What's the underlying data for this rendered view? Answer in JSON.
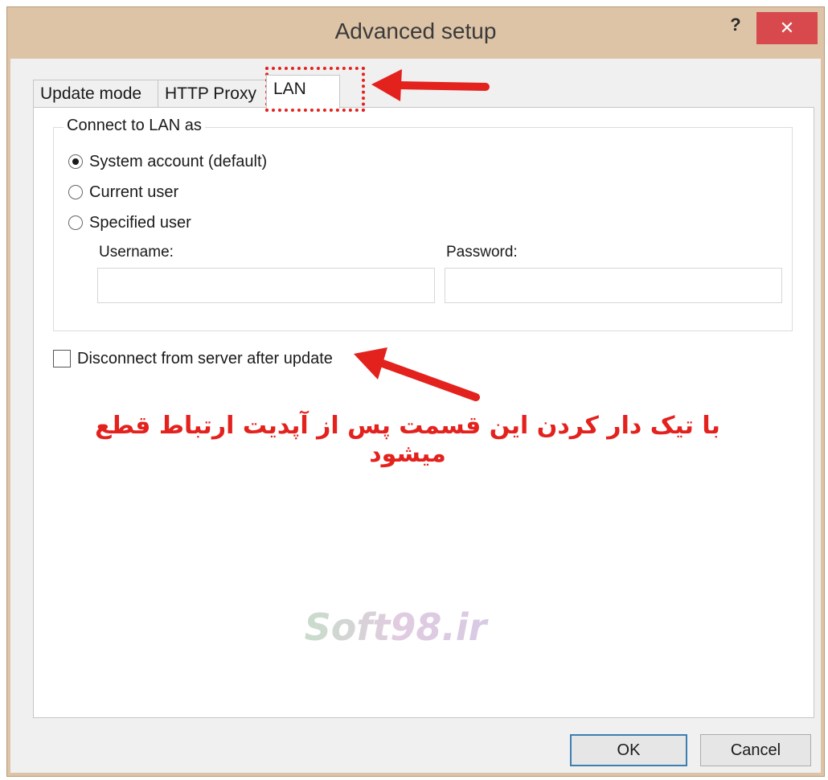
{
  "window": {
    "title": "Advanced setup",
    "help_label": "?",
    "close_label": "✕"
  },
  "tabs": [
    {
      "label": "Update mode",
      "active": false
    },
    {
      "label": "HTTP Proxy",
      "active": false
    },
    {
      "label": "LAN",
      "active": true
    }
  ],
  "connect_group": {
    "title": "Connect to LAN as",
    "options": [
      {
        "label": "System account (default)",
        "selected": true
      },
      {
        "label": "Current user",
        "selected": false
      },
      {
        "label": "Specified user",
        "selected": false
      }
    ],
    "username_label": "Username:",
    "username_value": "",
    "password_label": "Password:",
    "password_value": ""
  },
  "disconnect_checkbox": {
    "label": "Disconnect from server after update",
    "checked": false
  },
  "annotation_text": "با تیک دار کردن این قسمت  پس از آپدیت ارتباط قطع میشود",
  "watermark_text": "Soft98.ir",
  "buttons": {
    "ok": "OK",
    "cancel": "Cancel"
  },
  "colors": {
    "annotation_red": "#e3211d",
    "close_button": "#d7494d",
    "frame": "#ddc4a7"
  }
}
